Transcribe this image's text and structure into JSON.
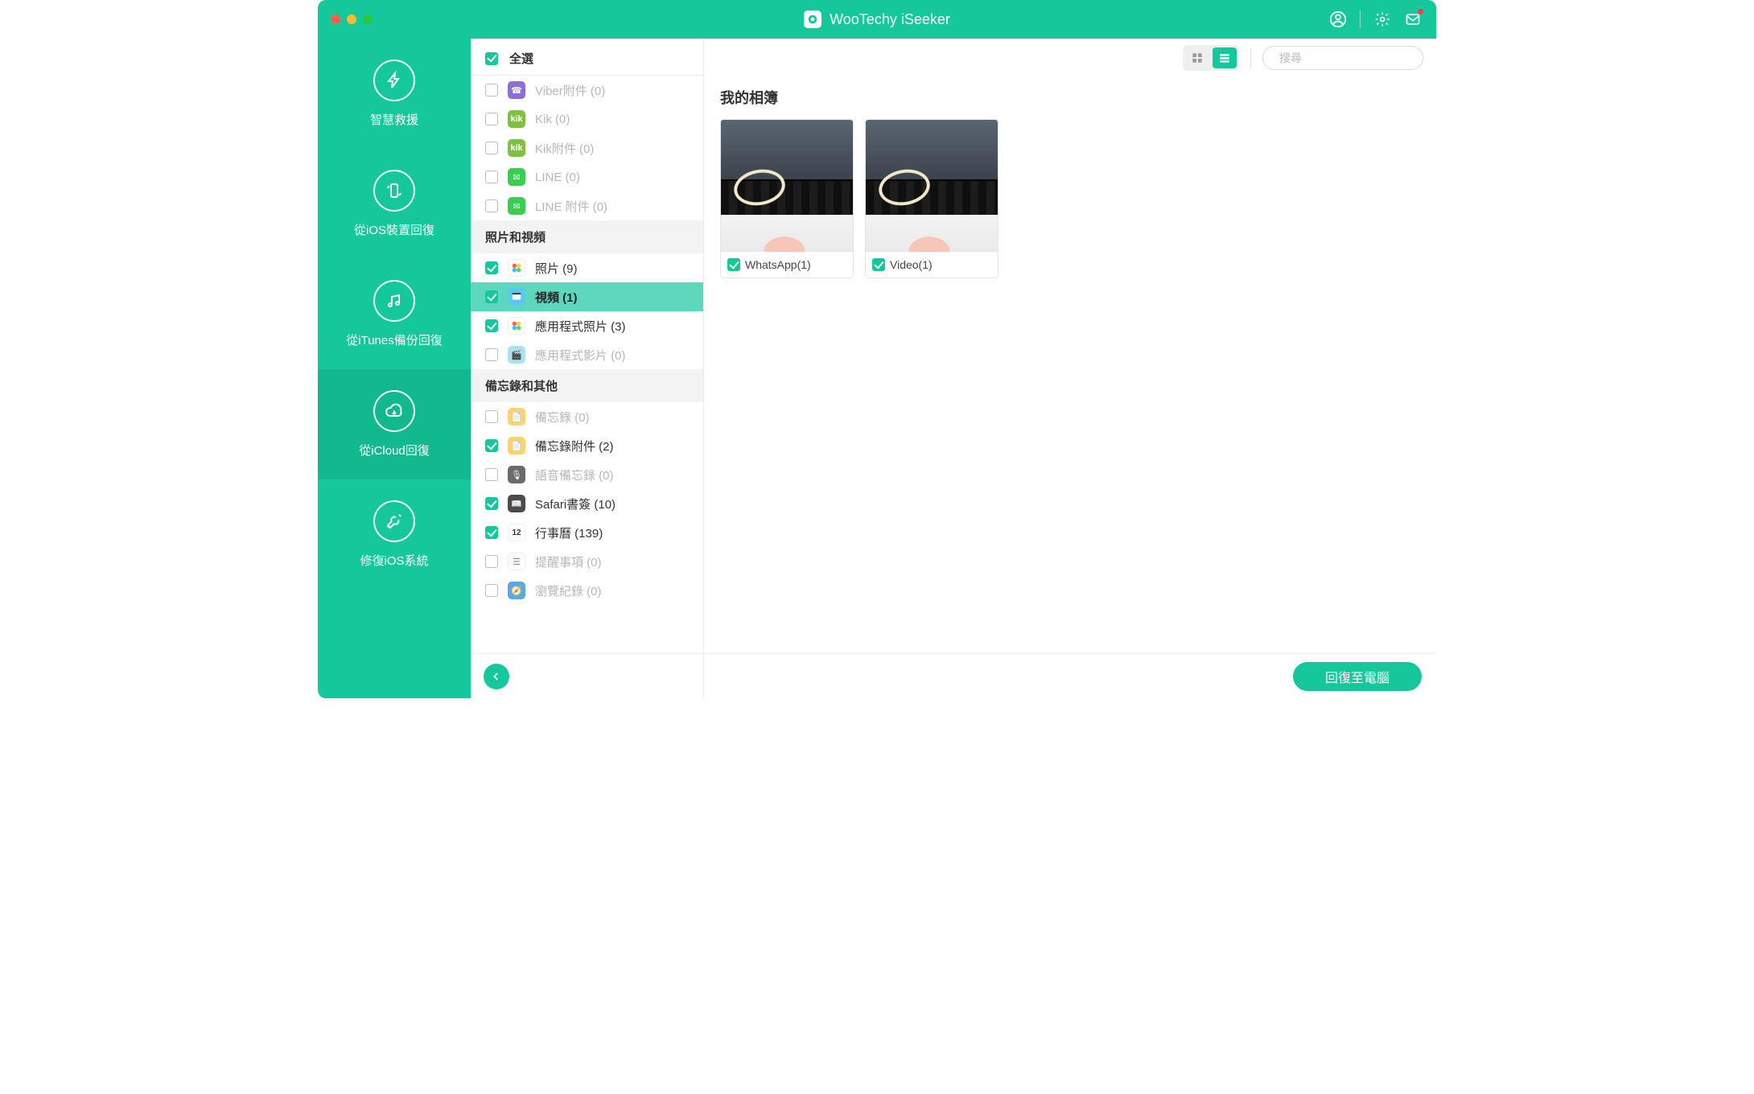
{
  "app": {
    "title": "WooTechy iSeeker"
  },
  "nav": {
    "items": [
      {
        "label": "智慧救援"
      },
      {
        "label": "從iOS裝置回復"
      },
      {
        "label": "從iTunes備份回復"
      },
      {
        "label": "從iCloud回復"
      },
      {
        "label": "修復iOS系統"
      }
    ]
  },
  "categories": {
    "select_all_label": "全選",
    "groups": {
      "photos_videos": "照片和視頻",
      "memos_other": "備忘錄和其他"
    },
    "items": {
      "viber_attach": "Viber附件 (0)",
      "kik": "Kik (0)",
      "kik_attach": "Kik附件 (0)",
      "line": "LINE (0)",
      "line_attach": "LINE 附件 (0)",
      "photos": "照片 (9)",
      "videos": "視頻 (1)",
      "app_photos": "應用程式照片 (3)",
      "app_videos": "應用程式影片 (0)",
      "notes": "備忘錄 (0)",
      "notes_attach": "備忘錄附件 (2)",
      "voice_memos": "語音備忘錄 (0)",
      "safari_bookmarks": "Safari書簽 (10)",
      "calendar": "行事曆 (139)",
      "reminders": "提醒事項 (0)",
      "history": "瀏覽紀錄 (0)"
    }
  },
  "main": {
    "section_title": "我的相簿",
    "albums": [
      {
        "label": "WhatsApp(1)"
      },
      {
        "label": "Video(1)"
      }
    ]
  },
  "toolbar": {
    "search_placeholder": "搜尋"
  },
  "footer": {
    "recover_button": "回復至電腦"
  }
}
